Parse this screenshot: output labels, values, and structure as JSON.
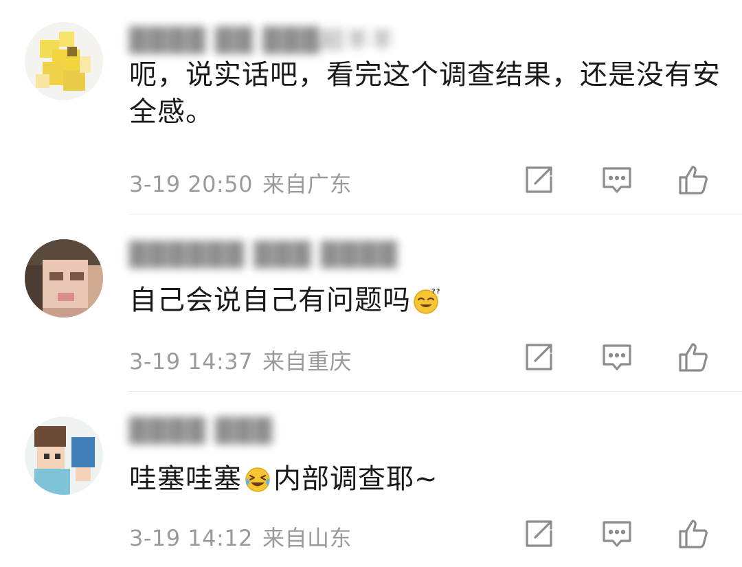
{
  "comments": [
    {
      "username": "████ ██ ███超羊羊",
      "text": "呃，说实话吧，看完这个调查结果，还是没有安全感。",
      "date": "3-19 20:50",
      "location": "来自广东",
      "emoji": ""
    },
    {
      "username": "██████ ███ ████",
      "text_before": "自己会说自己有问题吗",
      "date": "3-19 14:37",
      "location": "来自重庆",
      "emoji": "dizzy-smile-emoji"
    },
    {
      "username": "████ ███",
      "text_before": "哇塞哇塞",
      "text_after": "内部调查耶~",
      "date": "3-19 14:12",
      "location": "来自山东",
      "emoji": "laugh-cry-emoji"
    }
  ],
  "actions": {
    "repost_icon": "repost-icon",
    "reply_icon": "comment-icon",
    "like_icon": "thumbs-up-icon"
  },
  "colors": {
    "meta_text": "#9a9a9a",
    "icon_stroke": "#8c8c8c",
    "divider": "#e6e6e6"
  }
}
